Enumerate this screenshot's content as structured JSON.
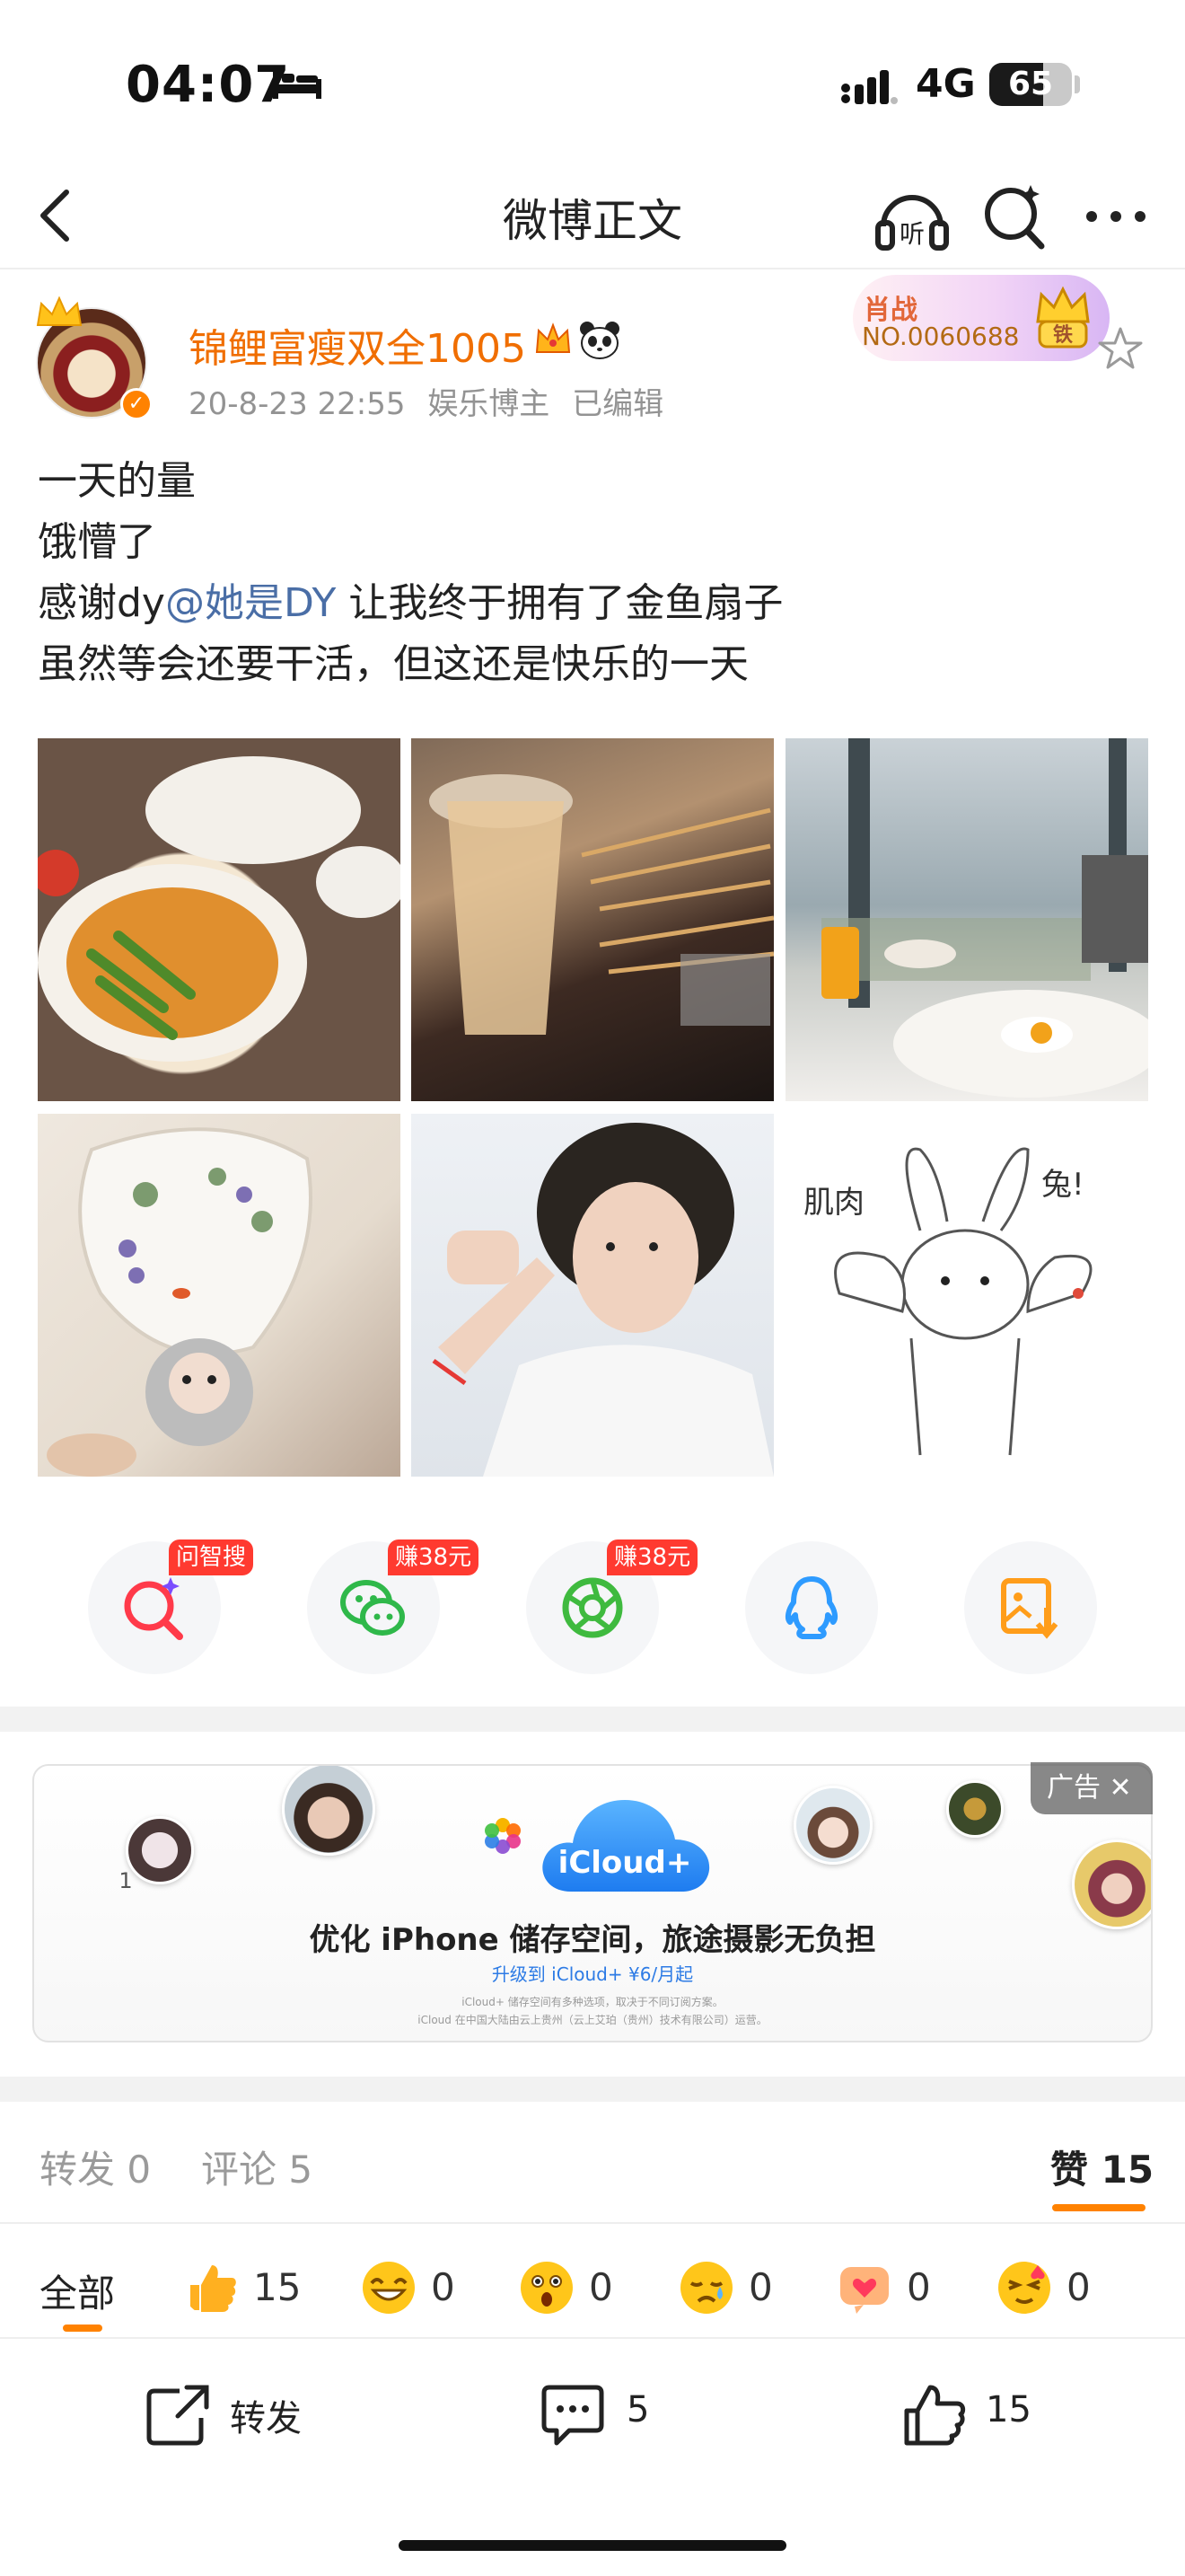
{
  "status_bar": {
    "time": "04:07",
    "network": "4G",
    "battery_percent": "65",
    "battery_level": 0.65,
    "icons": [
      "sleep-bed-icon",
      "signal-icon"
    ]
  },
  "nav": {
    "title": "微博正文",
    "listen_label": "听",
    "icons": [
      "back-icon",
      "listen-icon",
      "search-icon",
      "more-icon"
    ]
  },
  "post": {
    "author": "锦鲤富瘦双全1005",
    "time": "20-8-23 22:55",
    "role": "娱乐博主",
    "edited": "已编辑",
    "fan_tag": "肖战",
    "fan_number": "NO.0060688",
    "fan_badge_text": "铁",
    "text_lines": [
      "一天的量",
      "饿懵了"
    ],
    "thanks_prefix": "感谢dy",
    "mention": "@她是DY",
    "thanks_suffix": " 让我终于拥有了金鱼扇子",
    "last_line": "虽然等会还要干活，但这还是快乐的一天",
    "drawing_text_left": "肌肉",
    "drawing_text_right": "兔!",
    "colors": {
      "author": "#f06e00",
      "mention": "#4a6ea6",
      "accent": "#ff8200"
    }
  },
  "share": {
    "items": [
      {
        "name": "wenzhisou",
        "tag": "问智搜",
        "icon": "ai-search-icon"
      },
      {
        "name": "wechat",
        "tag": "赚38元",
        "icon": "wechat-icon"
      },
      {
        "name": "moments",
        "tag": "赚38元",
        "icon": "moments-icon"
      },
      {
        "name": "qq",
        "tag": "",
        "icon": "qq-icon"
      },
      {
        "name": "save-image",
        "tag": "",
        "icon": "save-image-icon"
      }
    ]
  },
  "ad": {
    "label": "广告",
    "close": "✕",
    "brand": "iCloud+",
    "headline": "优化 iPhone 储存空间，旅途摄影无负担",
    "sub": "升级到 iCloud+ ¥6/月起",
    "counter": "1",
    "fine1": "iCloud+ 储存空间有多种选项，取决于不同订阅方案。",
    "fine2": "iCloud 在中国大陆由云上贵州（云上艾珀（贵州）技术有限公司）运营。"
  },
  "tabs": {
    "repost": "转发 0",
    "comment": "评论 5",
    "like_label": "赞",
    "like_count": "15"
  },
  "reactions": {
    "all": "全部",
    "items": [
      {
        "icon": "thumbs-up-icon",
        "count": "15",
        "color": "#ffb020"
      },
      {
        "icon": "grin-emoji-icon",
        "count": "0",
        "color": "#ffc61a"
      },
      {
        "icon": "surprised-emoji-icon",
        "count": "0",
        "color": "#ffc61a"
      },
      {
        "icon": "sad-emoji-icon",
        "count": "0",
        "color": "#ffc61a"
      },
      {
        "icon": "heart-emoji-icon",
        "count": "0",
        "color": "#ffb37a"
      },
      {
        "icon": "love-emoji-icon",
        "count": "0",
        "color": "#ffc61a"
      }
    ]
  },
  "bottom_bar": {
    "repost": "转发",
    "comment_count": "5",
    "like_count": "15"
  }
}
